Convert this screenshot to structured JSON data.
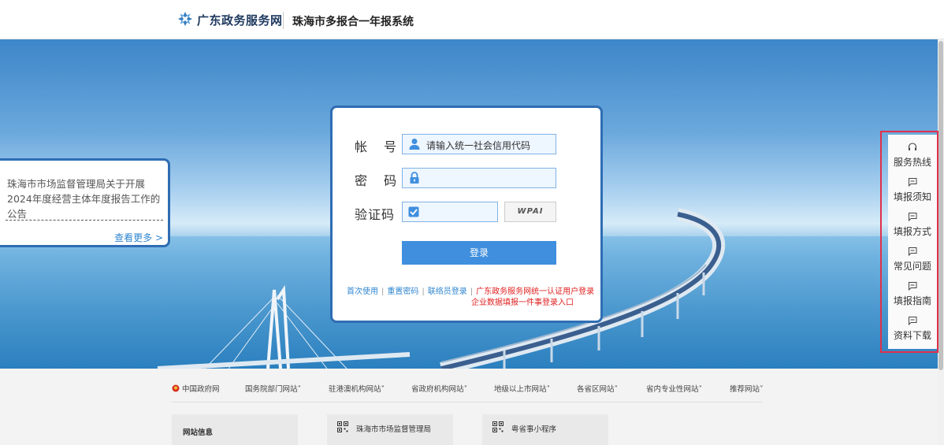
{
  "header": {
    "site_name": "广东政务服务网",
    "system_title": "珠海市多报合一年报系统"
  },
  "notice": {
    "text": "珠海市市场监督管理局关于开展2024年度经营主体年度报告工作的公告",
    "more_label": "查看更多 >"
  },
  "login": {
    "account_label": "帐 号",
    "account_placeholder": "请输入统一社会信用代码",
    "password_label": "密 码",
    "password_value": "",
    "captcha_label": "验证码",
    "captcha_value": "",
    "captcha_image_text": "WPAI",
    "submit_label": "登录",
    "links": {
      "first_use": "首次使用",
      "reset_password": "重置密码",
      "liaison_login": "联络员登录",
      "unified_login": "广东政务服务网统一认证用户登录",
      "enterprise_entry": "企业数据填报一件事登录入口"
    }
  },
  "side_panel": {
    "items": [
      {
        "label": "服务热线",
        "icon": "headset-icon"
      },
      {
        "label": "填报须知",
        "icon": "message-icon"
      },
      {
        "label": "填报方式",
        "icon": "message-icon"
      },
      {
        "label": "常见问题",
        "icon": "message-icon"
      },
      {
        "label": "填报指南",
        "icon": "message-icon"
      },
      {
        "label": "资料下载",
        "icon": "message-icon"
      }
    ]
  },
  "footer": {
    "nav": [
      {
        "label": "中国政府网"
      },
      {
        "label": "国务院部门网站"
      },
      {
        "label": "驻港澳机构网站"
      },
      {
        "label": "省政府机构网站"
      },
      {
        "label": "地级以上市网站"
      },
      {
        "label": "各省区网站"
      },
      {
        "label": "省内专业性网站"
      },
      {
        "label": "推荐网站"
      }
    ],
    "cards": {
      "site_info": "网站信息",
      "bureau": "珠海市市场监督管理局",
      "miniapp": "粤省事小程序"
    }
  },
  "colors": {
    "brand_blue": "#2f6db4",
    "button_blue": "#3f8fde",
    "link_blue": "#2f86d0",
    "alert_red": "#e02020",
    "panel_border_red": "#e0304a"
  }
}
